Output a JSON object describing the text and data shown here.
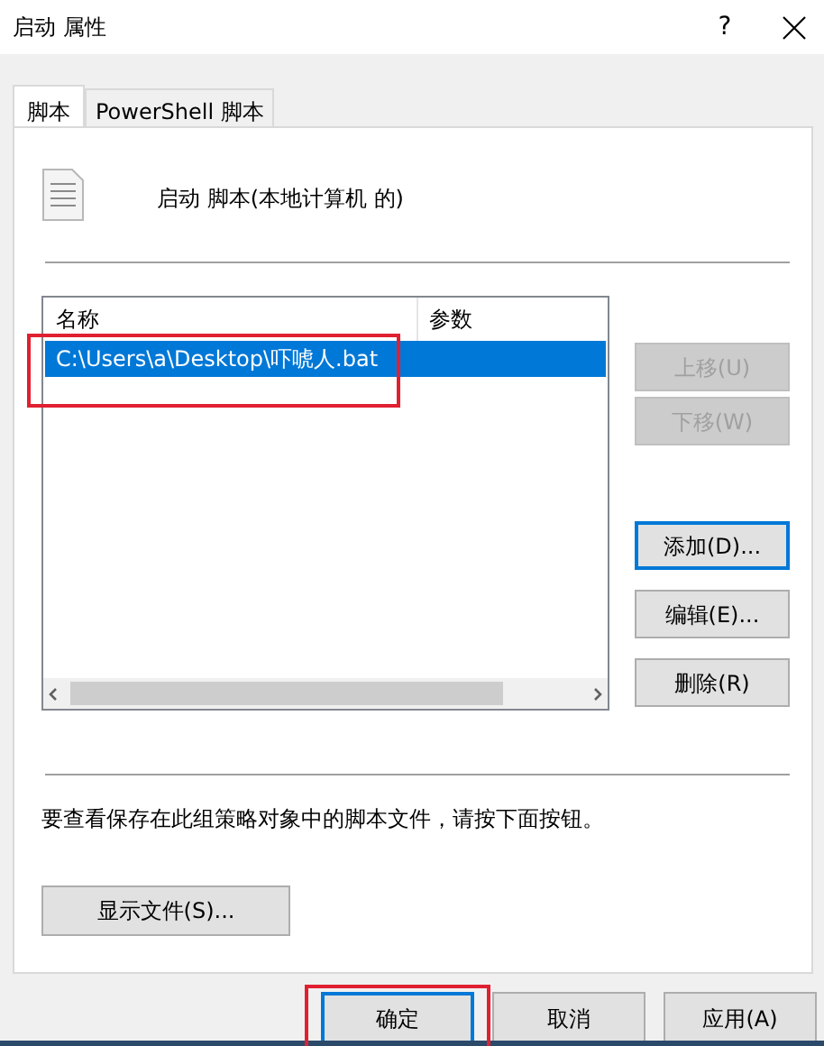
{
  "window": {
    "title": "启动 属性",
    "help": "?"
  },
  "tabs": [
    {
      "label": "脚本",
      "selected": true
    },
    {
      "label": "PowerShell 脚本",
      "selected": false
    }
  ],
  "heading": "启动 脚本(本地计算机 的)",
  "list": {
    "columns": [
      "名称",
      "参数"
    ],
    "rows": [
      {
        "name": "C:\\Users\\a\\Desktop\\吓唬人.bat",
        "selected": true,
        "highlighted": true
      }
    ]
  },
  "side_buttons": [
    {
      "label": "上移(U)",
      "disabled": true,
      "default": false
    },
    {
      "label": "下移(W)",
      "disabled": true,
      "default": false
    },
    {
      "label": "添加(D)...",
      "disabled": false,
      "default": true
    },
    {
      "label": "编辑(E)...",
      "disabled": false,
      "default": false
    },
    {
      "label": "删除(R)",
      "disabled": false,
      "default": false
    }
  ],
  "note": "要查看保存在此组策略对象中的脚本文件，请按下面按钮。",
  "show_files_button": "显示文件(S)...",
  "footer_buttons": [
    {
      "label": "确定",
      "default": true,
      "highlighted": true
    },
    {
      "label": "取消",
      "default": false,
      "highlighted": false
    },
    {
      "label": "应用(A)",
      "default": false,
      "highlighted": false
    }
  ]
}
